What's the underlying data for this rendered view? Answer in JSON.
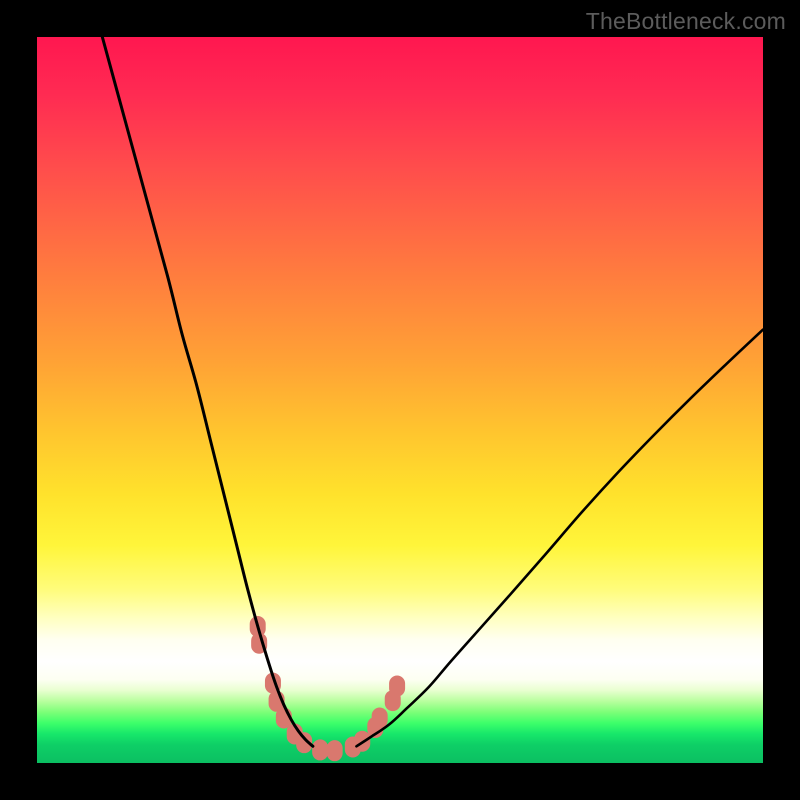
{
  "watermark": "TheBottleneck.com",
  "chart_data": {
    "type": "line",
    "title": "",
    "xlabel": "",
    "ylabel": "",
    "xlim": [
      0,
      100
    ],
    "ylim": [
      0,
      100
    ],
    "series": [
      {
        "name": "left-curve",
        "x": [
          9,
          12,
          15,
          18,
          20,
          22,
          24,
          26,
          27.5,
          29,
          30.5,
          32,
          33,
          34,
          35,
          36,
          37,
          38
        ],
        "values": [
          100,
          89,
          78,
          67,
          59,
          52,
          44,
          36,
          30,
          24,
          18.5,
          13.5,
          10.5,
          8,
          6,
          4.4,
          3.2,
          2.3
        ]
      },
      {
        "name": "right-curve",
        "x": [
          44,
          46,
          48.5,
          51,
          54,
          57,
          61,
          65,
          70,
          75,
          80,
          85,
          90,
          95,
          100
        ],
        "values": [
          2.3,
          3.6,
          5.3,
          7.6,
          10.5,
          14,
          18.5,
          23,
          28.7,
          34.5,
          40,
          45.2,
          50.2,
          55,
          59.7
        ]
      },
      {
        "name": "valley-markers-left",
        "x": [
          30.4,
          30.6,
          32.5,
          33,
          34,
          35.5,
          36.8,
          39,
          41
        ],
        "values": [
          18.8,
          16.5,
          11.0,
          8.5,
          6.2,
          4.0,
          2.8,
          1.8,
          1.7
        ]
      },
      {
        "name": "valley-markers-right",
        "x": [
          43.5,
          44.8,
          46.6,
          47.2,
          49.0,
          49.6
        ],
        "values": [
          2.2,
          3.0,
          4.9,
          6.2,
          8.6,
          10.6
        ]
      }
    ],
    "colors": {
      "curve": "#000000",
      "marker": "#d9786e"
    }
  }
}
